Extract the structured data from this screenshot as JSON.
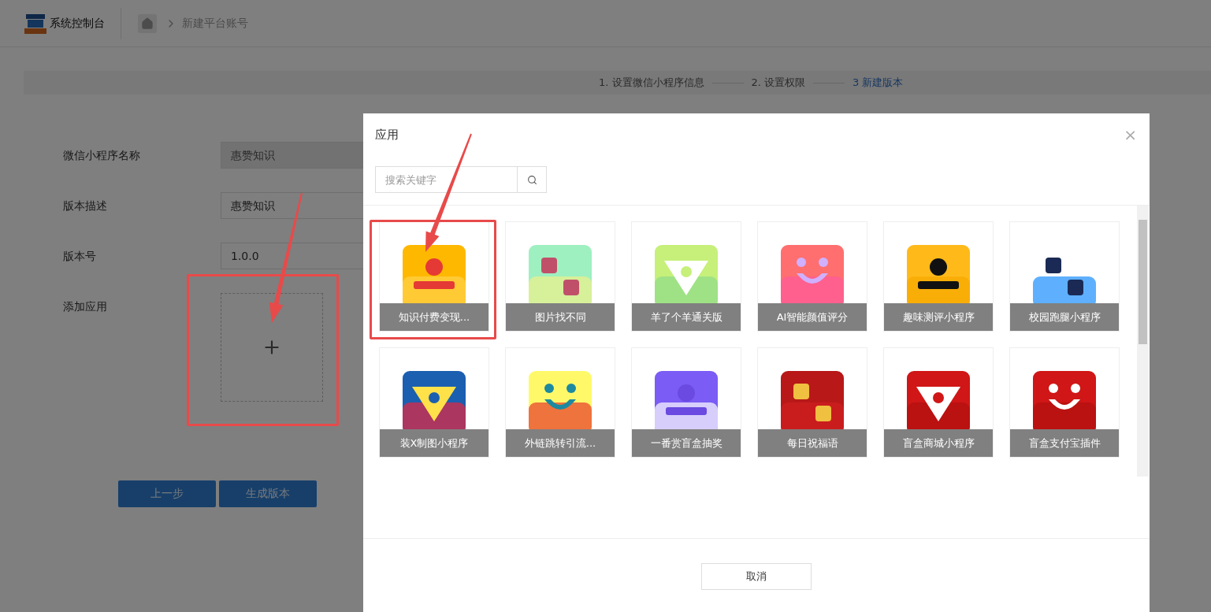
{
  "header": {
    "logo_text": "系统控制台",
    "breadcrumb": "新建平台账号"
  },
  "steps": [
    {
      "label": "1. 设置微信小程序信息",
      "selected": false
    },
    {
      "label": "2. 设置权限",
      "selected": false
    },
    {
      "label": "3 新建版本",
      "selected": true
    }
  ],
  "form": {
    "fields": [
      {
        "label": "微信小程序名称",
        "value": "惠赞知识",
        "disabled": true
      },
      {
        "label": "版本描述",
        "value": "惠赞知识",
        "disabled": false
      },
      {
        "label": "版本号",
        "value": "1.0.0",
        "disabled": false
      }
    ],
    "upload_label": "添加应用",
    "buttons": [
      "上一步",
      "生成版本"
    ]
  },
  "dialog": {
    "title": "应用",
    "close": "×",
    "search": {
      "placeholder": "搜索关键字"
    },
    "apps": [
      {
        "name": "知识付费变现..."
      },
      {
        "name": "图片找不同"
      },
      {
        "name": "羊了个羊通关版"
      },
      {
        "name": "AI智能颜值评分"
      },
      {
        "name": "趣味测评小程序"
      },
      {
        "name": "校园跑腿小程序"
      },
      {
        "name": "装X制图小程序"
      },
      {
        "name": "外链跳转引流..."
      },
      {
        "name": "一番赏盲盒抽奖"
      },
      {
        "name": "每日祝福语"
      },
      {
        "name": "盲盒商城小程序"
      },
      {
        "name": "盲盒支付宝插件"
      }
    ],
    "cancel": "取消"
  }
}
